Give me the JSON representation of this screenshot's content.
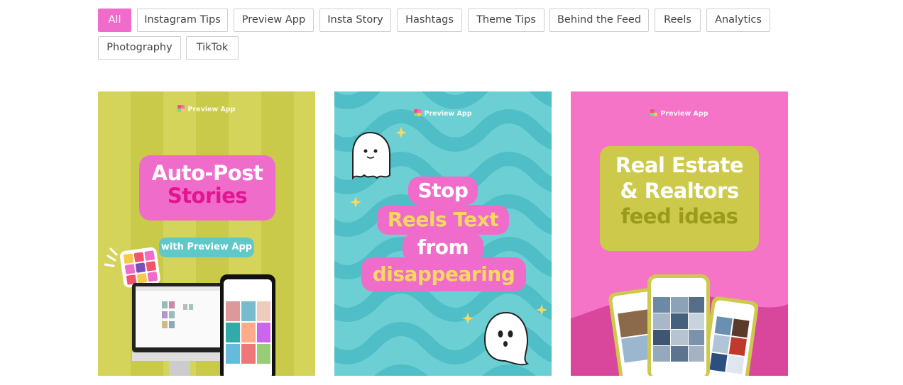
{
  "filters": [
    {
      "label": "All",
      "active": true
    },
    {
      "label": "Instagram Tips"
    },
    {
      "label": "Preview App"
    },
    {
      "label": "Insta Story"
    },
    {
      "label": "Hashtags"
    },
    {
      "label": "Theme Tips"
    },
    {
      "label": "Behind the Feed"
    },
    {
      "label": "Reels"
    },
    {
      "label": "Analytics"
    },
    {
      "label": "Photography"
    },
    {
      "label": "TikTok"
    }
  ],
  "cards": [
    {
      "brand": "Preview App",
      "title_line1": "Auto-Post",
      "title_line2": "Stories",
      "subtitle": "with Preview App",
      "bg": "#c9c94a",
      "accent": "#f06ccb"
    },
    {
      "brand": "Preview App",
      "line1": "Stop",
      "line2": "Reels Text",
      "line3": "from",
      "line4": "disappearing",
      "bg": "#6ccfd4",
      "accent": "#f06ccb",
      "highlight": "#f7d860"
    },
    {
      "brand": "Preview App",
      "line1": "Real Estate",
      "line2": "& Realtors",
      "line3": "feed ideas",
      "bg": "#f574c8",
      "box": "#cdc94b",
      "highlight": "#9a9a1c"
    }
  ]
}
